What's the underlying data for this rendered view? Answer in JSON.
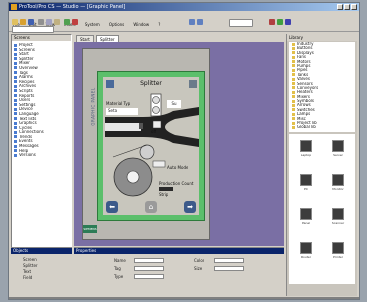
{
  "window": {
    "title": "ProTool/Pro CS — Studio — [Graphic Panel]"
  },
  "menu": {
    "items": [
      "File",
      "Edit",
      "View",
      "Insert",
      "System",
      "Options",
      "Window",
      "?"
    ]
  },
  "left_panel": {
    "header": "Screens",
    "items": [
      "Project",
      "Screens",
      "Start",
      "Splitter",
      "Mixer",
      "Overview",
      "Tags",
      "Alarms",
      "Recipes",
      "Archives",
      "Scripts",
      "Reports",
      "Users",
      "Settings",
      "Device",
      "Language",
      "Text lists",
      "Graphics",
      "Cycles",
      "Connections",
      "Trends",
      "Events",
      "Messages",
      "Help",
      "Versions"
    ]
  },
  "tabs": [
    "Start",
    "Splitter"
  ],
  "device": {
    "side_label": "GRAPHIC PANEL",
    "brand": "SIEMENS"
  },
  "hmi": {
    "title": "Splitter",
    "material_label": "Material Typ",
    "material_value": "Seta",
    "readout": "Su",
    "off_label": "off",
    "auto_label": "Auto Mode",
    "prod_label": "Production Count",
    "prod_value": "Strip",
    "nav_prev": "⬅",
    "nav_next": "➡",
    "nav_home": "⌂"
  },
  "right_panel": {
    "header": "Library",
    "tree_items": [
      "Industry",
      "Buttons",
      "Displays",
      "Fans",
      "Motors",
      "Pumps",
      "Pipes",
      "Tanks",
      "Valves",
      "Sensors",
      "Conveyors",
      "Heaters",
      "Mixers",
      "Symbols",
      "Arrows",
      "Switches",
      "Lamps",
      "Misc",
      "Project lib",
      "Global lib"
    ],
    "gallery": [
      "Laptop",
      "Server",
      "PC",
      "Monitor",
      "Panel",
      "Scanner",
      "Router",
      "Printer"
    ]
  },
  "bottom_left": {
    "header": "Objects",
    "items": [
      "Screen",
      "Splitter",
      "Text",
      "Field"
    ]
  },
  "properties": {
    "header": "Properties",
    "labels": [
      "Name",
      "Tag",
      "Type",
      "Color",
      "Size"
    ]
  },
  "colors": {
    "canvas": "#7a6fa4",
    "hmi_frame": "#5bbf6b",
    "titlebar": "#0a246a"
  }
}
